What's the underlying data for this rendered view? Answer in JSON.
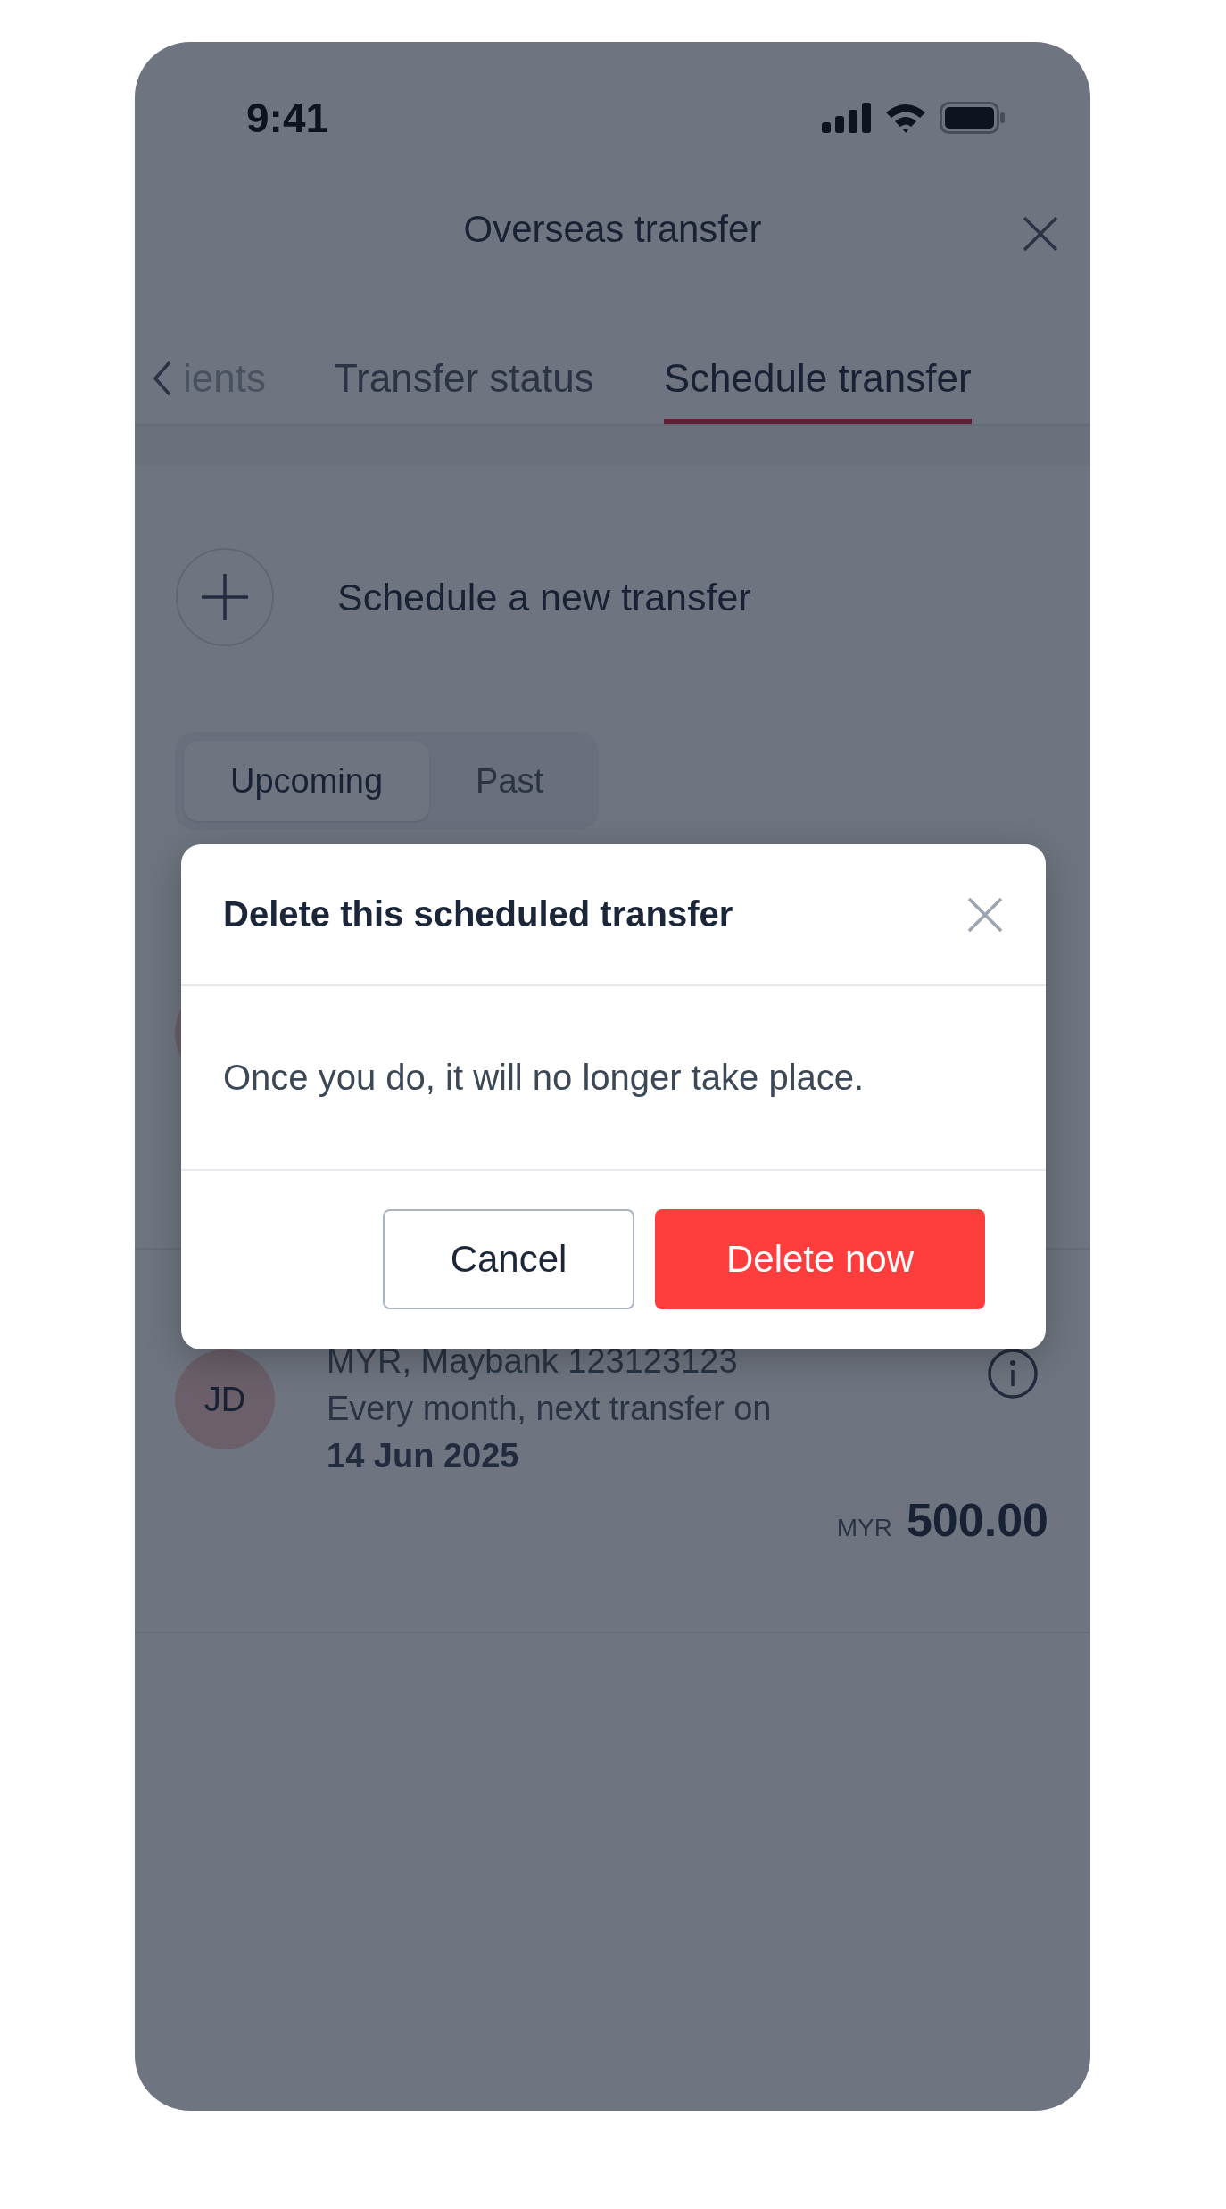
{
  "status_bar": {
    "time": "9:41"
  },
  "header": {
    "title": "Overseas transfer"
  },
  "tabs": [
    {
      "label": "ients",
      "selected": false,
      "cut_off": true
    },
    {
      "label": "Transfer status",
      "selected": false,
      "cut_off": false
    },
    {
      "label": "Schedule transfer",
      "selected": true,
      "cut_off": false
    }
  ],
  "new_transfer": {
    "label": "Schedule a new transfer"
  },
  "segments": [
    {
      "label": "Upcoming",
      "selected": true
    },
    {
      "label": "Past",
      "selected": false
    }
  ],
  "transfers": [
    {
      "initials": "JD",
      "account": "MYR, Maybank 123123123",
      "frequency": "Every month, next transfer on",
      "next_date": "14 Jun 2025",
      "currency": "MYR",
      "amount": "500.00"
    }
  ],
  "dialog": {
    "title": "Delete this scheduled transfer",
    "message": "Once you do, it will no longer take place.",
    "buttons": [
      {
        "label": "Cancel",
        "kind": "secondary"
      },
      {
        "label": "Delete now",
        "kind": "danger"
      }
    ]
  }
}
